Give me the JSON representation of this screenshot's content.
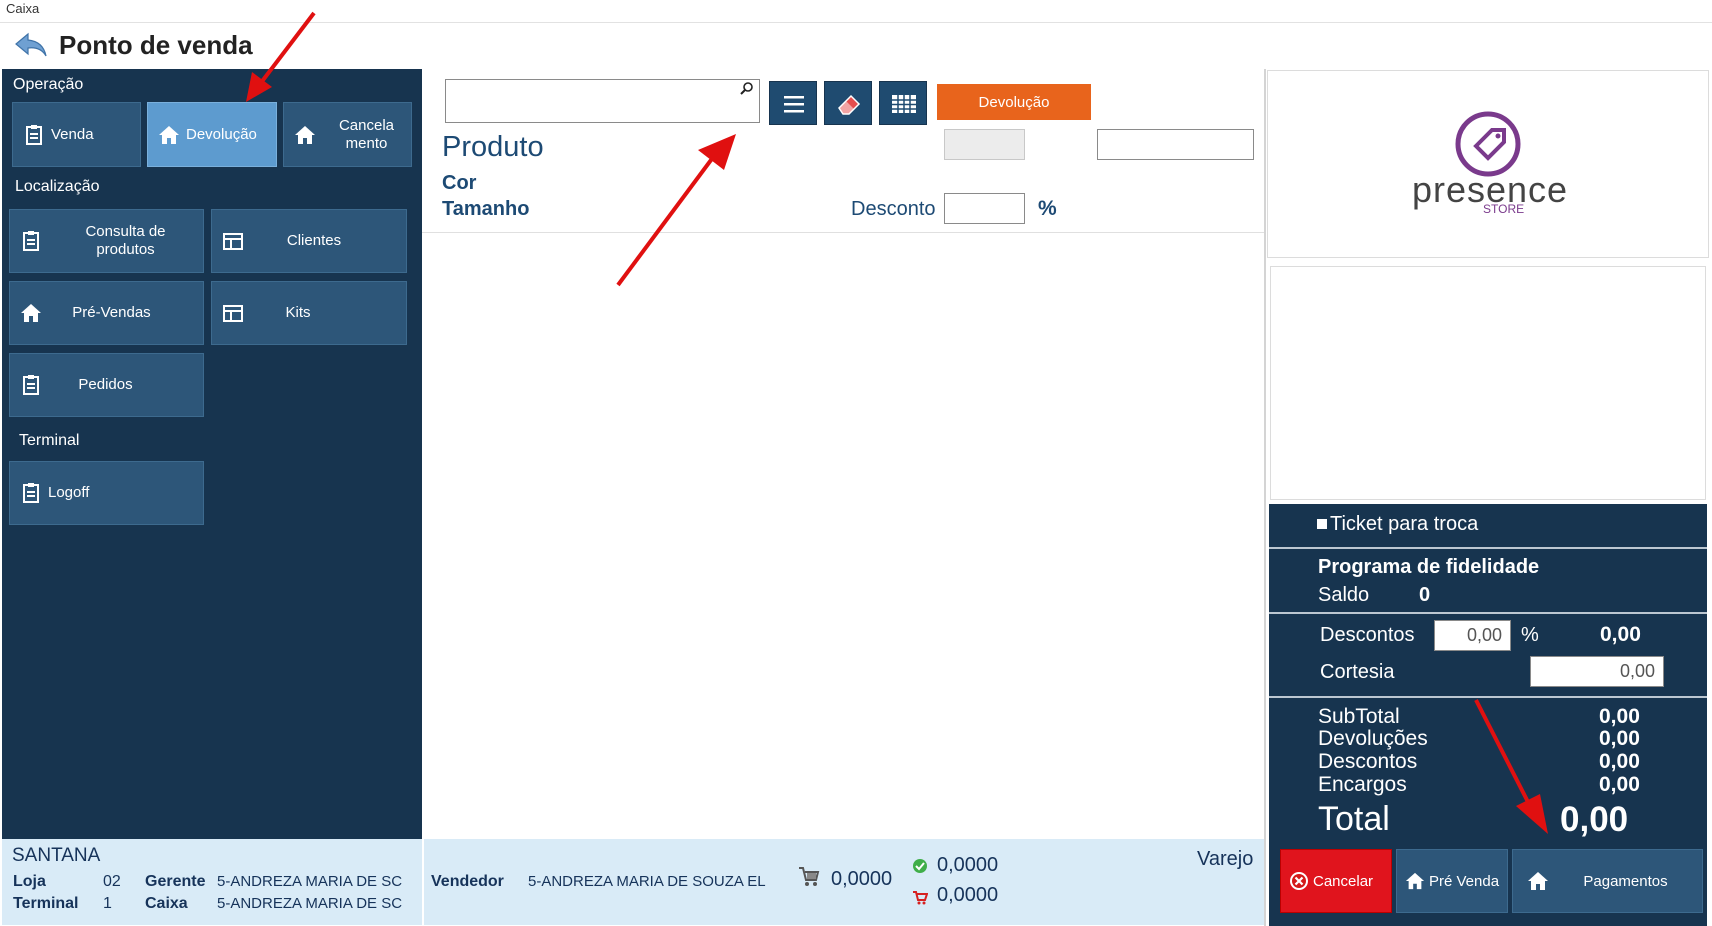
{
  "window": {
    "title": "Caixa"
  },
  "header": {
    "title": "Ponto de venda",
    "back_icon": "back-arrow-icon"
  },
  "sidebar": {
    "operacao_label": "Operação",
    "localizacao_label": "Localização",
    "terminal_label": "Terminal",
    "buttons": {
      "venda": "Venda",
      "devolucao": "Devolução",
      "cancelamento_l1": "Cancela",
      "cancelamento_l2": "mento",
      "consulta_l1": "Consulta de",
      "consulta_l2": "produtos",
      "clientes": "Clientes",
      "pre_vendas": "Pré-Vendas",
      "kits": "Kits",
      "pedidos": "Pedidos",
      "logoff": "Logoff"
    },
    "active": "devolucao"
  },
  "footer_left": {
    "store_name": "SANTANA",
    "loja_label": "Loja",
    "loja_value": "02",
    "gerente_label": "Gerente",
    "gerente_value": "5-ANDREZA MARIA DE SC",
    "terminal_label": "Terminal",
    "terminal_value": "1",
    "caixa_label": "Caixa",
    "caixa_value": "5-ANDREZA MARIA DE SC"
  },
  "footer_mid": {
    "vendedor_label": "Vendedor",
    "vendedor_value": "5-ANDREZA MARIA DE SOUZA EL",
    "cart_value": "0,0000",
    "green_value": "0,0000",
    "red_value": "0,0000",
    "tabela": "Varejo"
  },
  "product": {
    "search_value": "",
    "devolucao_button": "Devolução",
    "produto_label": "Produto",
    "cor_label": "Cor",
    "tamanho_label": "Tamanho",
    "desconto_label": "Desconto",
    "desconto_value": "",
    "percent": "%"
  },
  "logo": {
    "brand": "presence",
    "sub": "STORE"
  },
  "right": {
    "ticket_label": "Ticket para troca",
    "fidelidade_title": "Programa de fidelidade",
    "saldo_label": "Saldo",
    "saldo_value": "0",
    "descontos_label": "Descontos",
    "descontos_input": "0,00",
    "descontos_pct": "%",
    "descontos_value": "0,00",
    "cortesia_label": "Cortesia",
    "cortesia_input": "0,00",
    "subtotal_label": "SubTotal",
    "subtotal_value": "0,00",
    "devolucoes_label": "Devoluções",
    "devolucoes_value": "0,00",
    "descontos2_label": "Descontos",
    "descontos2_value": "0,00",
    "encargos_label": "Encargos",
    "encargos_value": "0,00",
    "total_label": "Total",
    "total_value": "0,00"
  },
  "actions": {
    "cancelar": "Cancelar",
    "pre_venda": "Pré Venda",
    "pagamentos": "Pagamentos"
  },
  "colors": {
    "sidebar_bg": "#17344f",
    "button_bg": "#2d5679",
    "active_button": "#5d9bcf",
    "orange": "#e8641c",
    "cancel_red": "#e0141d",
    "brand_purple": "#7a3a8c"
  }
}
